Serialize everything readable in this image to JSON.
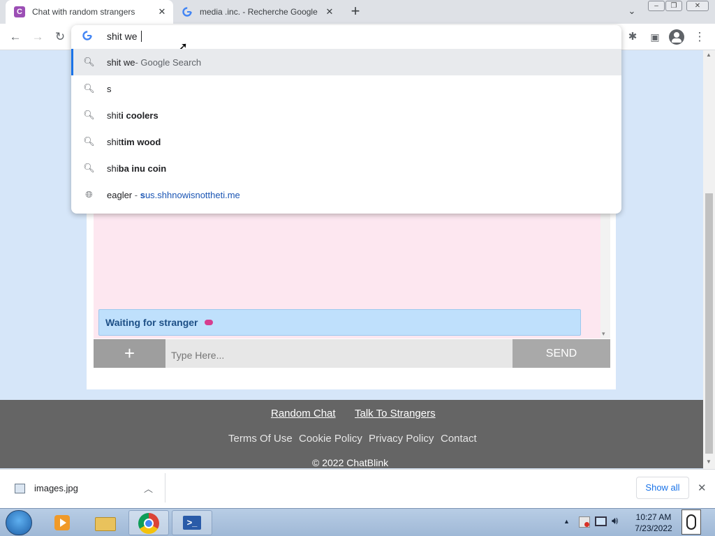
{
  "browser": {
    "tabs": [
      {
        "title": "Chat with random strangers",
        "favicon": "C"
      },
      {
        "title": "media .inc. - Recherche Google",
        "favicon": "google-icon"
      }
    ],
    "new_tab_label": "+",
    "address_value": "shit we"
  },
  "omnibox": {
    "suggestions": [
      {
        "normal": "shit we",
        "bold": "",
        "suffix": " - Google Search",
        "url": "",
        "icon": "search-icon"
      },
      {
        "normal": "s",
        "bold": "",
        "suffix": "",
        "url": "",
        "icon": "search-icon"
      },
      {
        "normal": "shit",
        "bold": "i coolers",
        "suffix": "",
        "url": "",
        "icon": "search-icon"
      },
      {
        "normal": "shit",
        "bold": "tim wood",
        "suffix": "",
        "url": "",
        "icon": "search-icon"
      },
      {
        "normal": "shi",
        "bold": "ba inu coin",
        "suffix": "",
        "url": "",
        "icon": "search-icon"
      },
      {
        "normal": "eagler",
        "bold": "",
        "suffix": " - ",
        "url_bold": "s",
        "url": "us.shhnowisnottheti.me",
        "icon": "globe-icon"
      }
    ]
  },
  "chat": {
    "status": "Waiting for stranger",
    "plus_label": "+",
    "input_placeholder": "Type Here...",
    "send_label": "SEND"
  },
  "footer": {
    "links_primary": [
      "Random Chat",
      "Talk To Strangers"
    ],
    "links_secondary": [
      "Terms Of Use",
      "Cookie Policy",
      "Privacy Policy",
      "Contact"
    ],
    "copyright": "© 2022 ChatBlink"
  },
  "downloads": {
    "file": "images.jpg",
    "show_all": "Show all"
  },
  "taskbar": {
    "time": "10:27 AM",
    "date": "7/23/2022"
  },
  "colors": {
    "page_bg": "#d6e6f9",
    "footer_bg": "#656565",
    "status_bg": "#bfe0fc",
    "accent": "#1a73e8"
  }
}
